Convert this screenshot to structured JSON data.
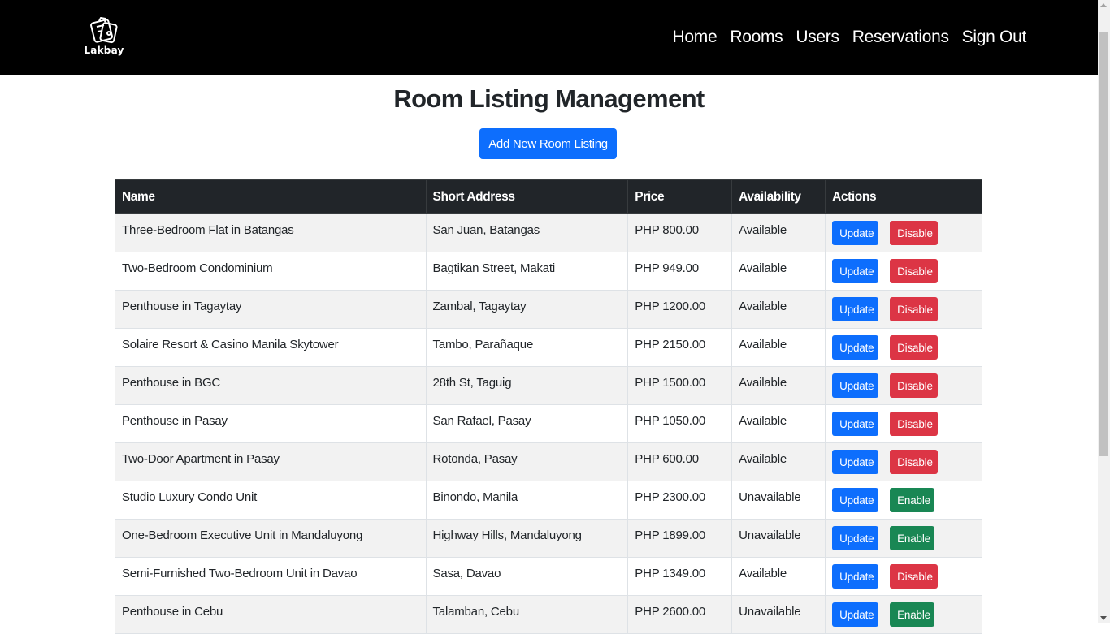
{
  "nav": {
    "brand": "Lakbay",
    "links": [
      "Home",
      "Rooms",
      "Users",
      "Reservations",
      "Sign Out"
    ]
  },
  "main": {
    "title": "Room Listing Management",
    "add_button": "Add New Room Listing"
  },
  "table": {
    "headers": [
      "Name",
      "Short Address",
      "Price",
      "Availability",
      "Actions"
    ],
    "update_label": "Update",
    "disable_label": "Disable",
    "enable_label": "Enable",
    "rows": [
      {
        "name": "Three-Bedroom Flat in Batangas",
        "address": "San Juan, Batangas",
        "price": "PHP 800.00",
        "availability": "Available",
        "toggle": "Disable"
      },
      {
        "name": "Two-Bedroom Condominium",
        "address": "Bagtikan Street, Makati",
        "price": "PHP 949.00",
        "availability": "Available",
        "toggle": "Disable"
      },
      {
        "name": "Penthouse in Tagaytay",
        "address": "Zambal, Tagaytay",
        "price": "PHP 1200.00",
        "availability": "Available",
        "toggle": "Disable"
      },
      {
        "name": "Solaire Resort & Casino Manila Skytower",
        "address": "Tambo, Parañaque",
        "price": "PHP 2150.00",
        "availability": "Available",
        "toggle": "Disable"
      },
      {
        "name": "Penthouse in BGC",
        "address": "28th St, Taguig",
        "price": "PHP 1500.00",
        "availability": "Available",
        "toggle": "Disable"
      },
      {
        "name": "Penthouse in Pasay",
        "address": "San Rafael, Pasay",
        "price": "PHP 1050.00",
        "availability": "Available",
        "toggle": "Disable"
      },
      {
        "name": "Two-Door Apartment in Pasay",
        "address": "Rotonda, Pasay",
        "price": "PHP 600.00",
        "availability": "Available",
        "toggle": "Disable"
      },
      {
        "name": "Studio Luxury Condo Unit",
        "address": "Binondo, Manila",
        "price": "PHP 2300.00",
        "availability": "Unavailable",
        "toggle": "Enable"
      },
      {
        "name": "One-Bedroom Executive Unit in Mandaluyong",
        "address": "Highway Hills, Mandaluyong",
        "price": "PHP 1899.00",
        "availability": "Unavailable",
        "toggle": "Enable"
      },
      {
        "name": "Semi-Furnished Two-Bedroom Unit in Davao",
        "address": "Sasa, Davao",
        "price": "PHP 1349.00",
        "availability": "Available",
        "toggle": "Disable"
      },
      {
        "name": "Penthouse in Cebu",
        "address": "Talamban, Cebu",
        "price": "PHP 2600.00",
        "availability": "Unavailable",
        "toggle": "Enable"
      }
    ]
  },
  "colors": {
    "navbar": "#000000",
    "primary": "#0d6efd",
    "danger": "#dc3545",
    "success": "#198754",
    "table_header": "#212529"
  },
  "icons": {
    "brand": "suitcase-icon"
  }
}
